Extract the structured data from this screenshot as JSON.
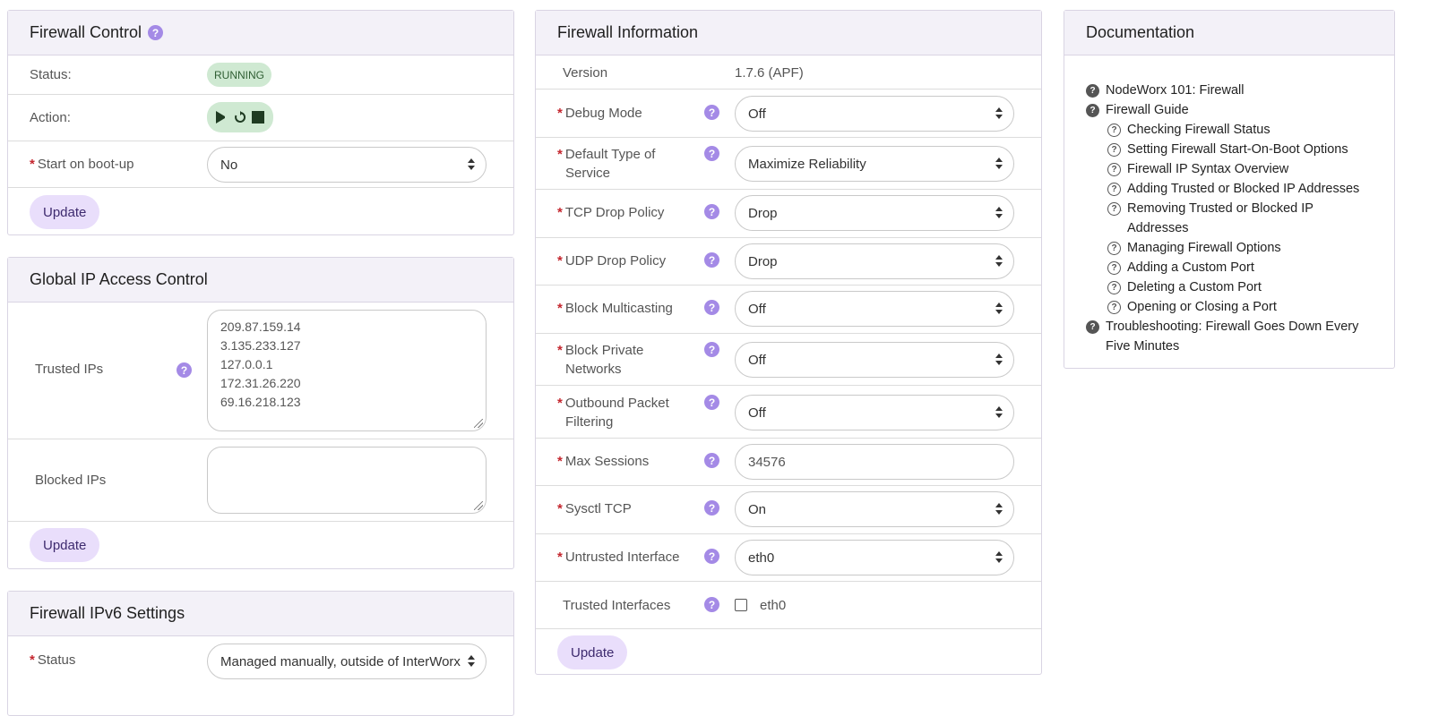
{
  "firewall_control": {
    "title": "Firewall Control",
    "status_label": "Status:",
    "status_value": "RUNNING",
    "action_label": "Action:",
    "boot_label": "Start on boot-up",
    "boot_value": "No",
    "update": "Update"
  },
  "global_ip": {
    "title": "Global IP Access Control",
    "trusted_label": "Trusted IPs",
    "trusted_ips": [
      "209.87.159.14",
      "3.135.233.127",
      "127.0.0.1",
      "172.31.26.220",
      "69.16.218.123"
    ],
    "blocked_label": "Blocked IPs",
    "update": "Update"
  },
  "ipv6": {
    "title": "Firewall IPv6 Settings",
    "status_label": "Status",
    "status_value": "Managed manually, outside of InterWorx"
  },
  "info": {
    "title": "Firewall Information",
    "version_label": "Version",
    "version_value": "1.7.6 (APF)",
    "fields": [
      {
        "line1": "Debug Mode",
        "line2": "",
        "value": "Off"
      },
      {
        "line1": "Default Type of",
        "line2": "Service",
        "value": "Maximize Reliability"
      },
      {
        "line1": "TCP Drop Policy",
        "line2": "",
        "value": "Drop"
      },
      {
        "line1": "UDP Drop Policy",
        "line2": "",
        "value": "Drop"
      },
      {
        "line1": "Block Multicasting",
        "line2": "",
        "value": "Off"
      },
      {
        "line1": "Block Private",
        "line2": "Networks",
        "value": "Off"
      },
      {
        "line1": "Outbound Packet",
        "line2": "Filtering",
        "value": "Off"
      },
      {
        "line1": "Max Sessions",
        "line2": "",
        "value": "34576"
      },
      {
        "line1": "Sysctl TCP",
        "line2": "",
        "value": "On"
      },
      {
        "line1": "Untrusted Interface",
        "line2": "",
        "value": "eth0"
      }
    ],
    "trusted_if_label": "Trusted Interfaces",
    "trusted_if_option": "eth0",
    "update": "Update"
  },
  "docs": {
    "title": "Documentation",
    "items": [
      {
        "text": "NodeWorx 101: Firewall",
        "sub": false
      },
      {
        "text": "Firewall Guide",
        "sub": false
      },
      {
        "text": "Checking Firewall Status",
        "sub": true
      },
      {
        "text": "Setting Firewall Start-On-Boot Options",
        "sub": true
      },
      {
        "text": "Firewall IP Syntax Overview",
        "sub": true
      },
      {
        "text": "Adding Trusted or Blocked IP Addresses",
        "sub": true
      },
      {
        "text": "Removing Trusted or Blocked IP Addresses",
        "sub": true
      },
      {
        "text": "Managing Firewall Options",
        "sub": true
      },
      {
        "text": "Adding a Custom Port",
        "sub": true
      },
      {
        "text": "Deleting a Custom Port",
        "sub": true
      },
      {
        "text": "Opening or Closing a Port",
        "sub": true
      },
      {
        "text": "Troubleshooting: Firewall Goes Down Every Five Minutes",
        "sub": false
      }
    ]
  },
  "icons": {
    "help": "question-circle-icon",
    "play": "play-icon",
    "restart": "restart-icon",
    "stop": "stop-icon"
  },
  "colors": {
    "accent": "#a48ae6",
    "button_bg": "#e9defb",
    "status_bg": "#cfe9d2",
    "required": "#c4262e",
    "header_bg": "#f3f1f8"
  }
}
